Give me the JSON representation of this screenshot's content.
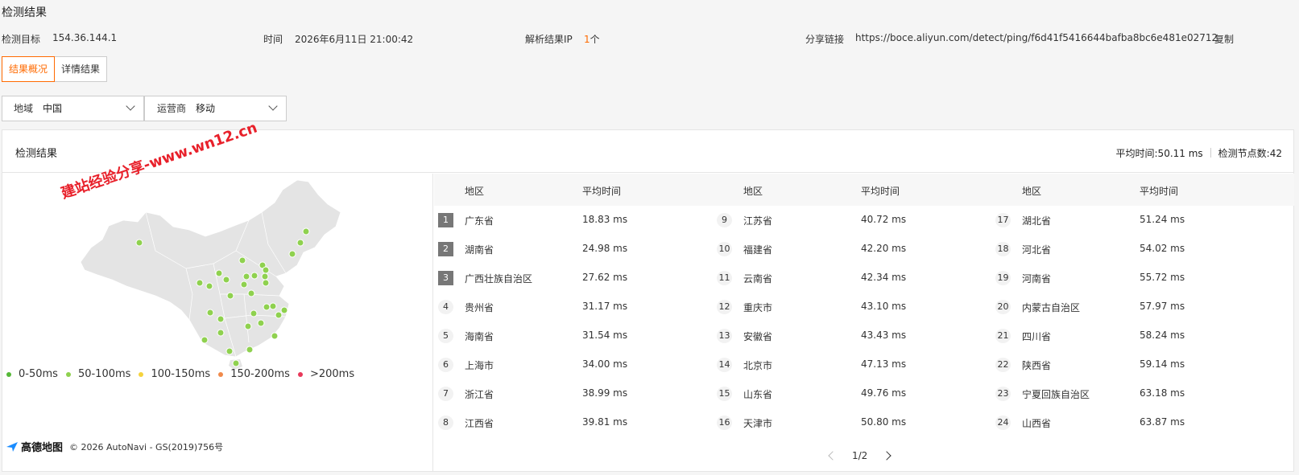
{
  "page": {
    "title": "检测结果"
  },
  "info": {
    "target_label": "检测目标",
    "target_value": "154.36.144.1",
    "time_label": "时间",
    "time_value": "2026年6月11日 21:00:42",
    "ip_label": "解析结果IP",
    "ip_count": "1",
    "ip_unit": "个",
    "share_label": "分享链接",
    "share_url": "https://boce.aliyun.com/detect/ping/f6d41f5416644bafba8bc6e481e02712",
    "copy_label": "复制"
  },
  "tabs": [
    {
      "label": "结果概况",
      "active": true
    },
    {
      "label": "详情结果",
      "active": false
    }
  ],
  "filters": {
    "region_label": "地域",
    "region_value": "中国",
    "carrier_label": "运营商",
    "carrier_value": "移动"
  },
  "panel": {
    "title": "检测结果",
    "avg_time": "平均时间:50.11 ms",
    "node_count": "检测节点数:42"
  },
  "watermark": "建站经验分享-www.wn12.cn",
  "legend": [
    {
      "label": "0-50ms",
      "color": "#55b837"
    },
    {
      "label": "50-100ms",
      "color": "#8fd14f"
    },
    {
      "label": "100-150ms",
      "color": "#f5d33d"
    },
    {
      "label": "150-200ms",
      "color": "#f08a4b"
    },
    {
      "label": ">200ms",
      "color": "#e8385a"
    }
  ],
  "map_credit": {
    "logo": "高德地图",
    "text": "© 2026 AutoNavi - GS(2019)756号"
  },
  "table": {
    "headers": [
      "地区",
      "平均时间"
    ],
    "columns": [
      [
        {
          "rank": "1",
          "region": "广东省",
          "time": "18.83 ms"
        },
        {
          "rank": "2",
          "region": "湖南省",
          "time": "24.98 ms"
        },
        {
          "rank": "3",
          "region": "广西壮族自治区",
          "time": "27.62 ms"
        },
        {
          "rank": "4",
          "region": "贵州省",
          "time": "31.17 ms"
        },
        {
          "rank": "5",
          "region": "海南省",
          "time": "31.54 ms"
        },
        {
          "rank": "6",
          "region": "上海市",
          "time": "34.00 ms"
        },
        {
          "rank": "7",
          "region": "浙江省",
          "time": "38.99 ms"
        },
        {
          "rank": "8",
          "region": "江西省",
          "time": "39.81 ms"
        }
      ],
      [
        {
          "rank": "9",
          "region": "江苏省",
          "time": "40.72 ms"
        },
        {
          "rank": "10",
          "region": "福建省",
          "time": "42.20 ms"
        },
        {
          "rank": "11",
          "region": "云南省",
          "time": "42.34 ms"
        },
        {
          "rank": "12",
          "region": "重庆市",
          "time": "43.10 ms"
        },
        {
          "rank": "13",
          "region": "安徽省",
          "time": "43.43 ms"
        },
        {
          "rank": "14",
          "region": "北京市",
          "time": "47.13 ms"
        },
        {
          "rank": "15",
          "region": "山东省",
          "time": "49.76 ms"
        },
        {
          "rank": "16",
          "region": "天津市",
          "time": "50.80 ms"
        }
      ],
      [
        {
          "rank": "17",
          "region": "湖北省",
          "time": "51.24 ms"
        },
        {
          "rank": "18",
          "region": "河北省",
          "time": "54.02 ms"
        },
        {
          "rank": "19",
          "region": "河南省",
          "time": "55.72 ms"
        },
        {
          "rank": "20",
          "region": "内蒙古自治区",
          "time": "57.97 ms"
        },
        {
          "rank": "21",
          "region": "四川省",
          "time": "58.24 ms"
        },
        {
          "rank": "22",
          "region": "陕西省",
          "time": "59.14 ms"
        },
        {
          "rank": "23",
          "region": "宁夏回族自治区",
          "time": "63.18 ms"
        },
        {
          "rank": "24",
          "region": "山西省",
          "time": "63.87 ms"
        }
      ]
    ]
  },
  "pager": {
    "text": "1/2"
  }
}
